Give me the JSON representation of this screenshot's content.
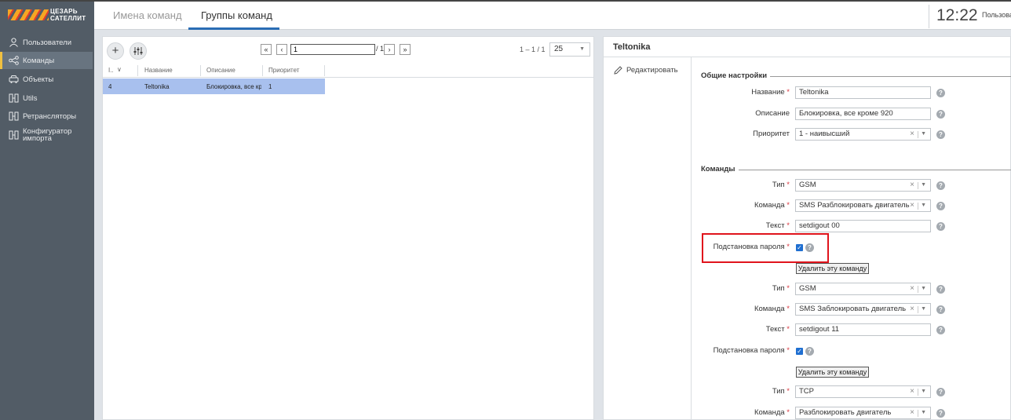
{
  "logo": {
    "line1": "ЦЕЗАРЬ",
    "line2": "САТЕЛЛИТ"
  },
  "header": {
    "tabs": [
      {
        "label": "Имена команд"
      },
      {
        "label": "Группы команд"
      }
    ],
    "clock": "12:22",
    "user": "Пользова"
  },
  "sidebar": {
    "items": [
      {
        "label": "Пользователи",
        "icon": "user-icon"
      },
      {
        "label": "Команды",
        "icon": "share-icon"
      },
      {
        "label": "Объекты",
        "icon": "car-icon"
      },
      {
        "label": "Utils",
        "icon": "tool-icon"
      },
      {
        "label": "Ретрансляторы",
        "icon": "relay-icon"
      },
      {
        "label": "Конфигуратор импорта",
        "label_line1": "Конфигуратор",
        "label_line2": "импорта",
        "icon": "import-icon"
      }
    ]
  },
  "list": {
    "add_icon": "+",
    "pagination": {
      "first": "«",
      "prev": "‹",
      "page": "1",
      "of": "/ 1",
      "next": "›",
      "last": "»",
      "range": "1 – 1 / 1",
      "page_size": "25"
    },
    "columns": [
      "I..",
      "Название",
      "Описание",
      "Приоритет"
    ],
    "rows": [
      {
        "id": "4",
        "name": "Teltonika",
        "description": "Блокировка, все кроме 920",
        "priority": "1"
      }
    ]
  },
  "detail": {
    "title": "Teltonika",
    "edit_label": "Редактировать",
    "general_section": "Общие настройки",
    "name_label": "Название",
    "name_value": "Teltonika",
    "description_label": "Описание",
    "description_value": "Блокировка, все кроме 920",
    "priority_label": "Приоритет",
    "priority_value": "1 - наивысший",
    "commands_section": "Команды",
    "type_label": "Тип",
    "command_label": "Команда",
    "text_label": "Текст",
    "password_label": "Подстановка пароля",
    "delete_label": "Удалить эту команду",
    "commands": [
      {
        "type": "GSM",
        "command": "SMS Разблокировать двигатель",
        "text": "setdigout 00",
        "password": true
      },
      {
        "type": "GSM",
        "command": "SMS Заблокировать двигатель",
        "text": "setdigout 11",
        "password": true
      },
      {
        "type": "TCP",
        "command": "Разблокировать двигатель"
      }
    ]
  }
}
